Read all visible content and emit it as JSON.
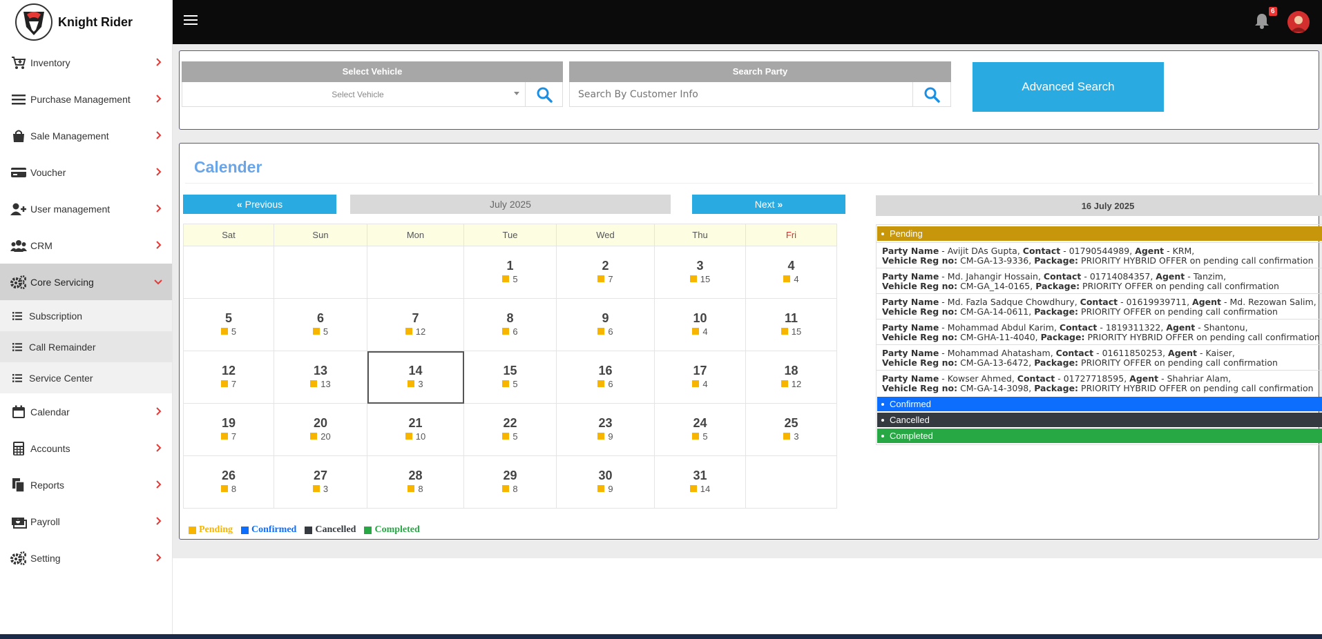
{
  "brand": {
    "name": "Knight Rider"
  },
  "sidebar": {
    "items": [
      {
        "label": "Inventory",
        "icon": "cart-plus-icon"
      },
      {
        "label": "Purchase Management",
        "icon": "bars-icon"
      },
      {
        "label": "Sale Management",
        "icon": "shopping-bag-icon"
      },
      {
        "label": "Voucher",
        "icon": "credit-card-icon"
      },
      {
        "label": "User management",
        "icon": "user-plus-icon"
      },
      {
        "label": "CRM",
        "icon": "users-icon"
      },
      {
        "label": "Core Servicing",
        "icon": "cogs-icon",
        "expanded": true
      },
      {
        "label": "Calendar",
        "icon": "calendar-icon"
      },
      {
        "label": "Accounts",
        "icon": "calculator-icon"
      },
      {
        "label": "Reports",
        "icon": "files-icon"
      },
      {
        "label": "Payroll",
        "icon": "money-icon"
      },
      {
        "label": "Setting",
        "icon": "cogs-icon"
      }
    ],
    "sub_items": [
      {
        "label": "Subscription"
      },
      {
        "label": "Call Remainder",
        "current": true
      },
      {
        "label": "Service Center"
      }
    ]
  },
  "topbar": {
    "notification_count": "6"
  },
  "search": {
    "vehicle_header": "Select Vehicle",
    "vehicle_placeholder": "Select Vehicle",
    "party_header": "Search Party",
    "party_placeholder": "Search By Customer Info",
    "advanced_label": "Advanced Search"
  },
  "calendar": {
    "title": "Calender",
    "prev_label": "Previous",
    "next_label": "Next",
    "month_label": "July 2025",
    "weekdays": [
      "Sat",
      "Sun",
      "Mon",
      "Tue",
      "Wed",
      "Thu",
      "Fri"
    ],
    "weeks": [
      [
        null,
        null,
        null,
        {
          "day": "1",
          "count": "5"
        },
        {
          "day": "2",
          "count": "7"
        },
        {
          "day": "3",
          "count": "15"
        },
        {
          "day": "4",
          "count": "4"
        }
      ],
      [
        {
          "day": "5",
          "count": "5"
        },
        {
          "day": "6",
          "count": "5"
        },
        {
          "day": "7",
          "count": "12"
        },
        {
          "day": "8",
          "count": "6"
        },
        {
          "day": "9",
          "count": "6"
        },
        {
          "day": "10",
          "count": "4"
        },
        {
          "day": "11",
          "count": "15"
        }
      ],
      [
        {
          "day": "12",
          "count": "7"
        },
        {
          "day": "13",
          "count": "13"
        },
        {
          "day": "14",
          "count": "3",
          "today": true
        },
        {
          "day": "15",
          "count": "5"
        },
        {
          "day": "16",
          "count": "6"
        },
        {
          "day": "17",
          "count": "4"
        },
        {
          "day": "18",
          "count": "12"
        }
      ],
      [
        {
          "day": "19",
          "count": "7"
        },
        {
          "day": "20",
          "count": "20"
        },
        {
          "day": "21",
          "count": "10"
        },
        {
          "day": "22",
          "count": "5"
        },
        {
          "day": "23",
          "count": "9"
        },
        {
          "day": "24",
          "count": "5"
        },
        {
          "day": "25",
          "count": "3"
        }
      ],
      [
        {
          "day": "26",
          "count": "8"
        },
        {
          "day": "27",
          "count": "3"
        },
        {
          "day": "28",
          "count": "8"
        },
        {
          "day": "29",
          "count": "8"
        },
        {
          "day": "30",
          "count": "9"
        },
        {
          "day": "31",
          "count": "14"
        },
        null
      ]
    ],
    "legend": [
      {
        "label": "Pending",
        "color": "#f7b500"
      },
      {
        "label": "Confirmed",
        "color": "#0d6efd"
      },
      {
        "label": "Cancelled",
        "color": "#343a40"
      },
      {
        "label": "Completed",
        "color": "#28a745"
      }
    ]
  },
  "detail": {
    "date_label": "16 July 2025",
    "statuses": [
      {
        "label": "Pending",
        "color": "#c8960a"
      },
      {
        "label": "Confirmed",
        "color": "#0d6efd"
      },
      {
        "label": "Cancelled",
        "color": "#343a40"
      },
      {
        "label": "Completed",
        "color": "#28a745"
      }
    ],
    "field_labels": {
      "party": "Party Name",
      "contact": "Contact",
      "agent": "Agent",
      "vehicle": "Vehicle Reg no:",
      "package": "Package:"
    },
    "pending_entries": [
      {
        "party": "Avijit DAs Gupta",
        "contact": "01790544989",
        "agent": "KRM",
        "vehicle": "CM-GA-13-9336",
        "package": "PRIORITY HYBRID OFFER on pending call confirmation"
      },
      {
        "party": "Md. Jahangir Hossain",
        "contact": "01714084357",
        "agent": "Tanzim",
        "vehicle": "CM-GA_14-0165",
        "package": "PRIORITY OFFER on pending call confirmation"
      },
      {
        "party": "Md. Fazla Sadque Chowdhury",
        "contact": "01619939711",
        "agent": "Md. Rezowan Salim",
        "vehicle": "CM-GA-14-0611",
        "package": "PRIORITY OFFER on pending call confirmation"
      },
      {
        "party": "Mohammad Abdul Karim",
        "contact": "1819311322",
        "agent": "Shantonu",
        "vehicle": "CM-GHA-11-4040",
        "package": "PRIORITY HYBRID OFFER on pending call confirmation"
      },
      {
        "party": "Mohammad Ahatasham",
        "contact": "01611850253",
        "agent": "Kaiser",
        "vehicle": "CM-GA-13-6472",
        "package": "PRIORITY OFFER on pending call confirmation"
      },
      {
        "party": "Kowser Ahmed",
        "contact": "01727718595",
        "agent": "Shahriar Alam",
        "vehicle": "CM-GA-14-3098",
        "package": "PRIORITY HYBRID OFFER on pending call confirmation"
      }
    ]
  }
}
